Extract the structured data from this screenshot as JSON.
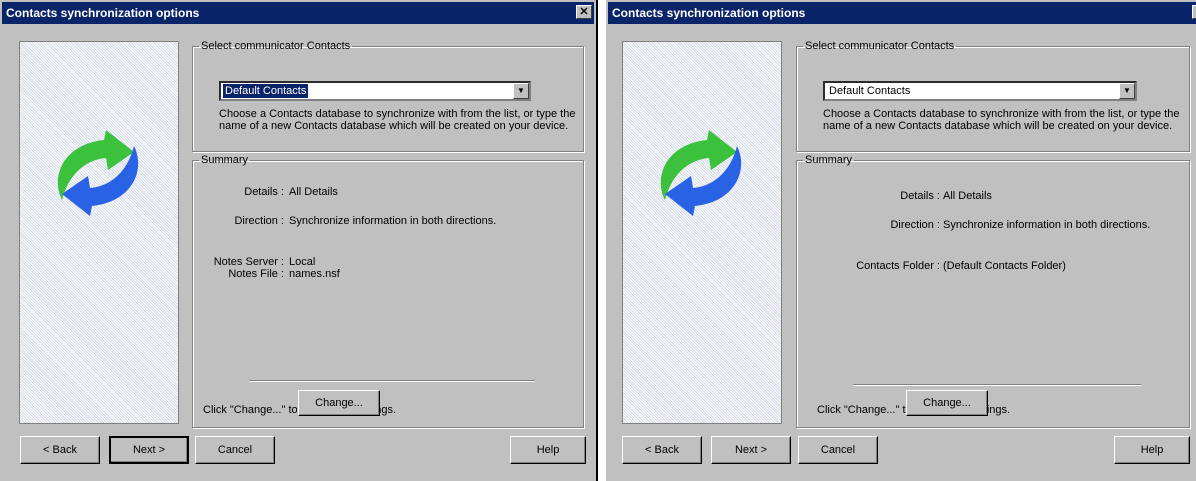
{
  "dialog_left": {
    "title": "Contacts synchronization options",
    "close": "✕",
    "select_group_legend": "Select communicator Contacts",
    "combo_value": "Default Contacts",
    "combo_arrow": "▼",
    "description": "Choose a Contacts database to synchronize with from the list, or type the name of a new Contacts database which will be created on your device.",
    "summary_legend": "Summary",
    "details_label": "Details :",
    "details_value": "All Details",
    "direction_label": "Direction :",
    "direction_value": "Synchronize information in both directions.",
    "notes_server_label": "Notes Server :",
    "notes_server_value": "Local",
    "notes_file_label": "Notes File :",
    "notes_file_value": "names.nsf",
    "hint": "Click \"Change...\" to alter these settings.",
    "change_button": "Change...",
    "back_button": "< Back",
    "next_button": "Next >",
    "cancel_button": "Cancel",
    "help_button": "Help"
  },
  "dialog_right": {
    "title": "Contacts synchronization options",
    "close": "✕",
    "select_group_legend": "Select communicator Contacts",
    "combo_value": "Default Contacts",
    "combo_arrow": "▼",
    "description": "Choose a Contacts database to synchronize with from the list, or type the name of a new Contacts database which will be created on your device.",
    "summary_legend": "Summary",
    "details_label": "Details :",
    "details_value": "All Details",
    "direction_label": "Direction :",
    "direction_value": "Synchronize information in both directions.",
    "contacts_folder_label": "Contacts Folder :",
    "contacts_folder_value": "(Default Contacts Folder)",
    "hint": "Click \"Change...\" to alter these settings.",
    "change_button": "Change...",
    "back_button": "< Back",
    "next_button": "Next >",
    "cancel_button": "Cancel",
    "help_button": "Help"
  },
  "icons": {
    "sync": "sync-arrows-icon",
    "close": "close-icon",
    "dropdown": "chevron-down-icon"
  },
  "colors": {
    "titlebar": "#0a246a",
    "dialog_bg": "#c0c0c0",
    "arrow_green": "#3cc13c",
    "arrow_blue": "#2a62e6"
  }
}
